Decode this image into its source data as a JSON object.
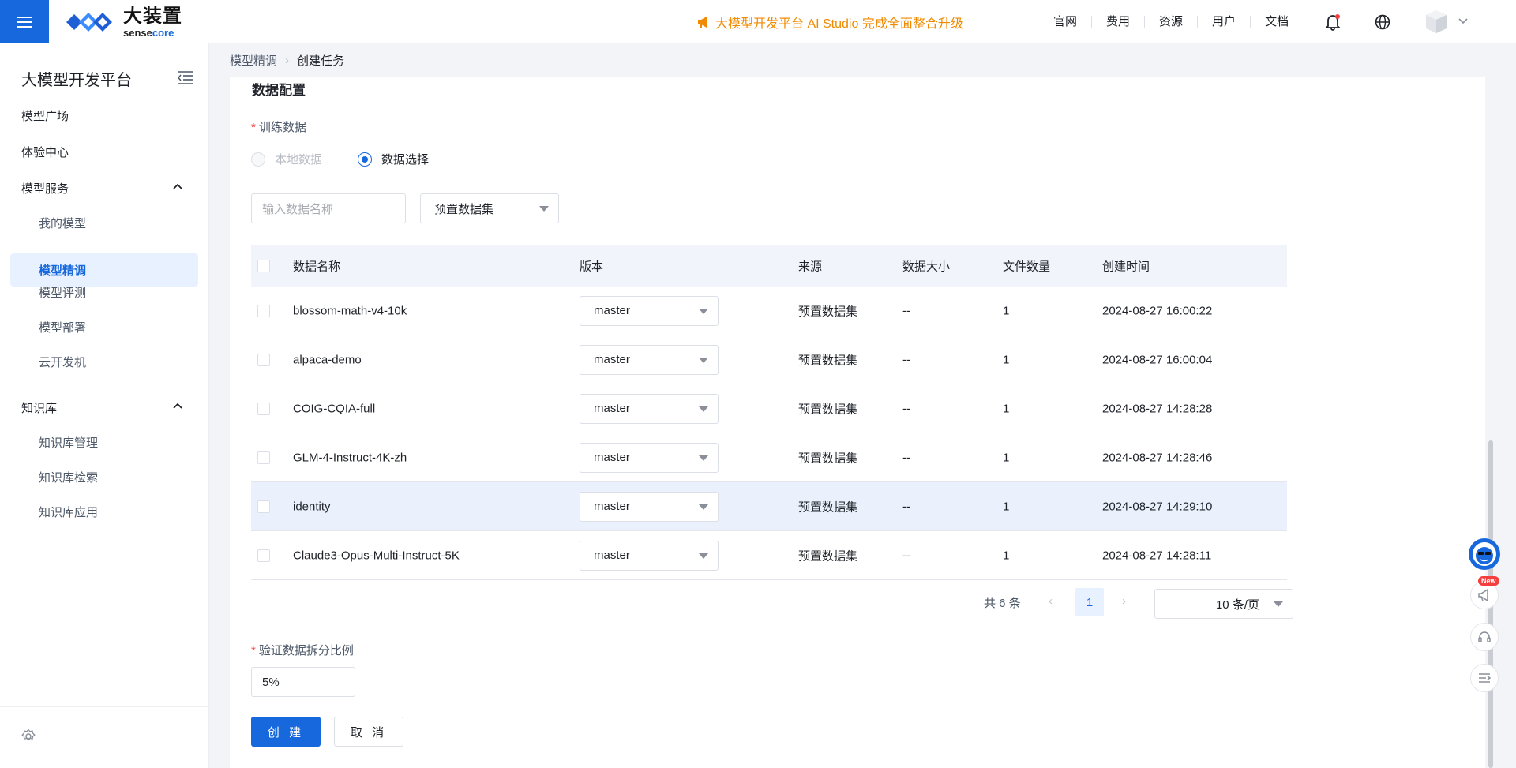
{
  "header": {
    "logo_cn": "大装置",
    "logo_en_prefix": "sense",
    "logo_en_suffix": "core",
    "announcement": "大模型开发平台 AI Studio 完成全面整合升级",
    "nav": [
      "官网",
      "费用",
      "资源",
      "用户",
      "文档"
    ]
  },
  "sidebar": {
    "title": "大模型开发平台",
    "items": [
      {
        "label": "模型广场"
      },
      {
        "label": "体验中心"
      },
      {
        "label": "模型服务"
      },
      {
        "label": "我的模型"
      },
      {
        "label": "模型精调"
      },
      {
        "label": "模型评测"
      },
      {
        "label": "模型部署"
      },
      {
        "label": "云开发机"
      },
      {
        "label": "知识库"
      },
      {
        "label": "知识库管理"
      },
      {
        "label": "知识库检索"
      },
      {
        "label": "知识库应用"
      }
    ]
  },
  "breadcrumb": {
    "parent": "模型精调",
    "current": "创建任务"
  },
  "form": {
    "section_title": "数据配置",
    "training_label": "训练数据",
    "radio_local": "本地数据",
    "radio_select": "数据选择",
    "search_placeholder": "输入数据名称",
    "dataset_type": "预置数据集",
    "split_label": "验证数据拆分比例",
    "split_value": "5%",
    "create_label": "创 建",
    "cancel_label": "取 消"
  },
  "table": {
    "headers": [
      "数据名称",
      "版本",
      "来源",
      "数据大小",
      "文件数量",
      "创建时间"
    ],
    "rows": [
      {
        "name": "blossom-math-v4-10k",
        "version": "master",
        "source": "预置数据集",
        "size": "--",
        "files": "1",
        "created": "2024-08-27 16:00:22"
      },
      {
        "name": "alpaca-demo",
        "version": "master",
        "source": "预置数据集",
        "size": "--",
        "files": "1",
        "created": "2024-08-27 16:00:04"
      },
      {
        "name": "COIG-CQIA-full",
        "version": "master",
        "source": "预置数据集",
        "size": "--",
        "files": "1",
        "created": "2024-08-27 14:28:28"
      },
      {
        "name": "GLM-4-Instruct-4K-zh",
        "version": "master",
        "source": "预置数据集",
        "size": "--",
        "files": "1",
        "created": "2024-08-27 14:28:46"
      },
      {
        "name": "identity",
        "version": "master",
        "source": "预置数据集",
        "size": "--",
        "files": "1",
        "created": "2024-08-27 14:29:10"
      },
      {
        "name": "Claude3-Opus-Multi-Instruct-5K",
        "version": "master",
        "source": "预置数据集",
        "size": "--",
        "files": "1",
        "created": "2024-08-27 14:28:11"
      }
    ]
  },
  "pagination": {
    "total": "共 6 条",
    "page": "1",
    "page_size": "10 条/页"
  },
  "float": {
    "new_badge": "New"
  },
  "colors": {
    "primary": "#1668dc",
    "announcement": "#f08a00",
    "required": "#f53f3f"
  }
}
